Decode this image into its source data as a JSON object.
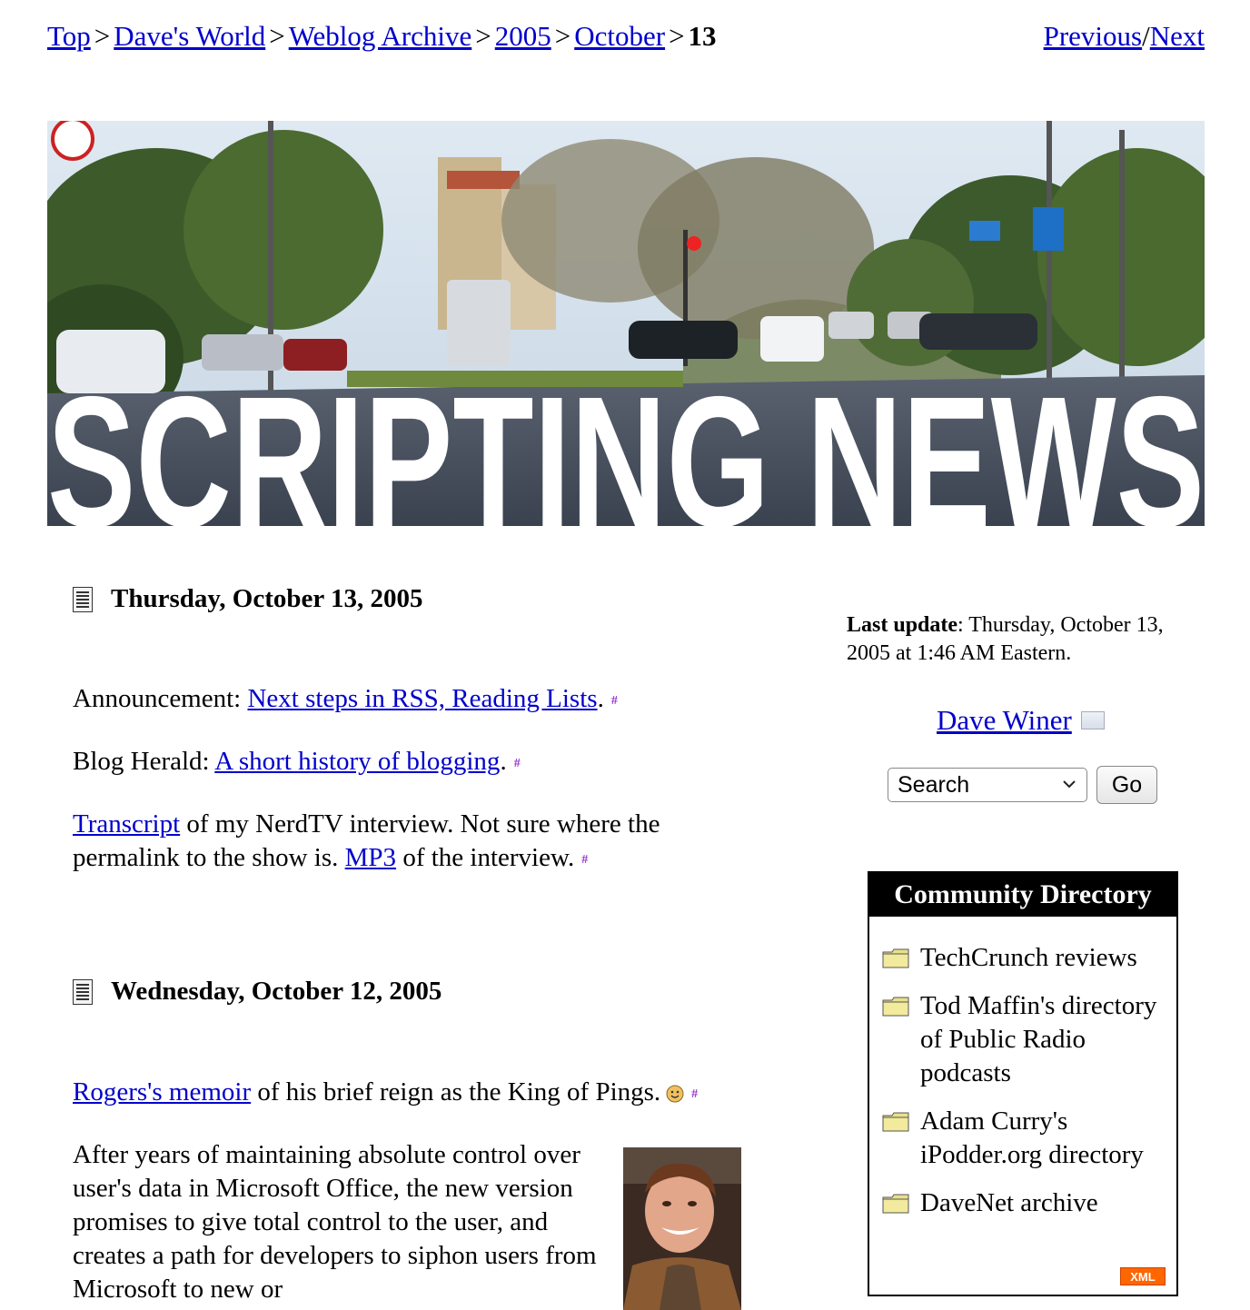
{
  "breadcrumb": {
    "top": "Top",
    "daves_world": "Dave's World",
    "weblog_archive": "Weblog Archive",
    "year": "2005",
    "month": "October",
    "day": "13",
    "separator": ">"
  },
  "nav": {
    "previous": "Previous",
    "slash": "/",
    "next": "Next"
  },
  "banner": {
    "title": "SCRIPTING NEWS"
  },
  "days": [
    {
      "date": "Thursday, October 13, 2005",
      "posts": {
        "p1_prefix": "Announcement: ",
        "p1_link": "Next steps in RSS, Reading Lists",
        "p1_suffix": ".",
        "p2_prefix": "Blog Herald: ",
        "p2_link": "A short history of blogging",
        "p2_suffix": ".",
        "p3_link1": "Transcript",
        "p3_text1": " of my NerdTV interview. Not sure where the permalink to the show is. ",
        "p3_link2": "MP3",
        "p3_text2": " of the interview."
      }
    },
    {
      "date": "Wednesday, October 12, 2005",
      "posts": {
        "p1_link": "Rogers's memoir",
        "p1_text": " of his brief reign as the King of Pings.",
        "p2_text": "After years of maintaining absolute control over user's data in Microsoft Office, the new version promises to give total control to the user, and creates a path for developers to siphon users from Microsoft to new or"
      }
    }
  ],
  "permalink_mark": "#",
  "sidebar": {
    "last_update_label": "Last update",
    "last_update_value": ": Thursday, October 13, 2005 at 1:46 AM Eastern.",
    "author": "Dave Winer",
    "search_selected": "Search",
    "go_label": "Go",
    "directory_title": "Community Directory",
    "directory_items": [
      "TechCrunch reviews",
      "Tod Maffin's directory of Public Radio podcasts",
      "Adam Curry's iPodder.org directory",
      "DaveNet archive"
    ],
    "xml_badge": "XML"
  },
  "icons": {
    "day_icon": "document-icon",
    "folder_icon": "folder-icon",
    "smiley_icon": "smiley-icon"
  }
}
